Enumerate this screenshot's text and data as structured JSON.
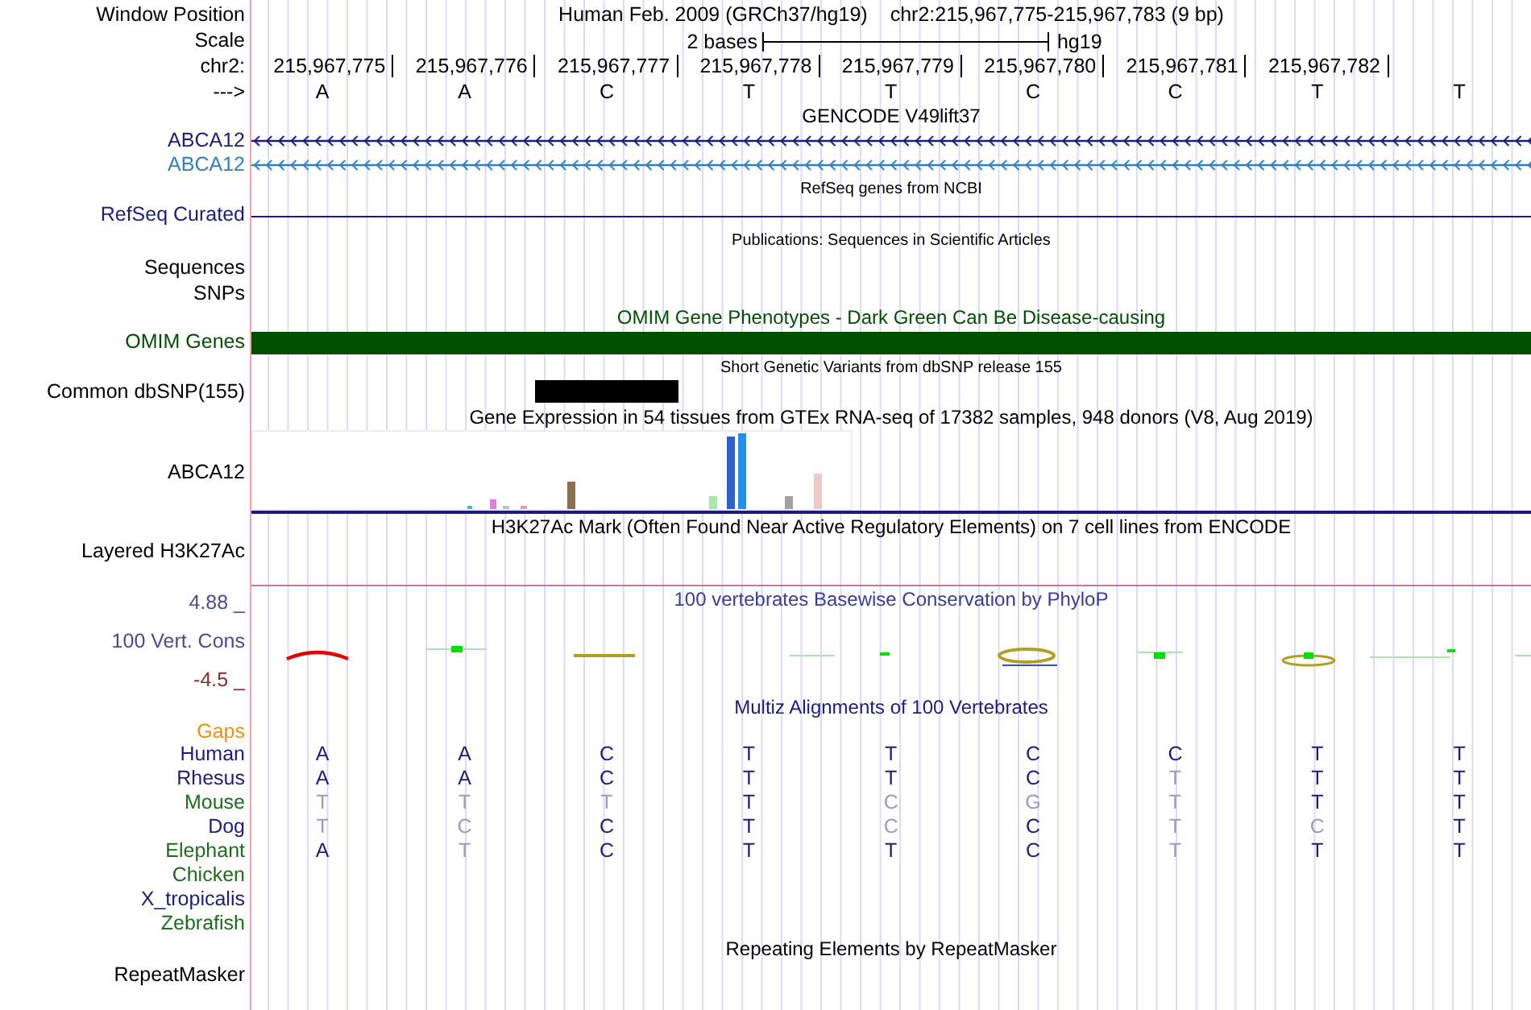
{
  "header": {
    "label": "Window Position",
    "title": "Human Feb. 2009 (GRCh37/hg19)",
    "position": "chr2:215,967,775-215,967,783 (9 bp)"
  },
  "scale": {
    "label": "Scale",
    "span": "2 bases",
    "assembly": "hg19"
  },
  "ruler": {
    "label": "chr2:",
    "positions": [
      "215,967,775",
      "215,967,776",
      "215,967,777",
      "215,967,778",
      "215,967,779",
      "215,967,780",
      "215,967,781",
      "215,967,782"
    ]
  },
  "sequence": {
    "label": "--->",
    "bases": [
      "A",
      "A",
      "C",
      "T",
      "T",
      "C",
      "C",
      "T",
      "T"
    ]
  },
  "gencode": {
    "heading": "GENCODE V49lift37",
    "transcripts": [
      {
        "label": "ABCA12",
        "color": "#1c1c80"
      },
      {
        "label": "ABCA12",
        "color": "#2e80c0"
      }
    ]
  },
  "refseq": {
    "heading": "RefSeq genes from NCBI",
    "label": "RefSeq Curated"
  },
  "publications": {
    "heading": "Publications: Sequences in Scientific Articles",
    "label_lines": [
      "Sequences",
      "SNPs"
    ]
  },
  "omim": {
    "heading": "OMIM Gene Phenotypes - Dark Green Can Be Disease-causing",
    "label": "OMIM Genes"
  },
  "dbsnp": {
    "heading": "Short Genetic Variants from dbSNP release 155",
    "label": "Common dbSNP(155)"
  },
  "gtex": {
    "heading": "Gene Expression in 54 tissues from GTEx RNA-seq of 17382 samples, 948 donors (V8, Aug 2019)",
    "label": "ABCA12"
  },
  "h3k27ac": {
    "heading": "H3K27Ac Mark (Often Found Near Active Regulatory Elements) on 7 cell lines from ENCODE",
    "label": "Layered H3K27Ac"
  },
  "phylop": {
    "heading": "100 vertebrates Basewise Conservation by PhyloP",
    "max": "4.88 _",
    "label": "100 Vert. Cons",
    "min": "-4.5 _"
  },
  "multiz": {
    "heading": "Multiz Alignments of 100 Vertebrates",
    "gaps_label": "Gaps",
    "species": [
      {
        "name": "Human",
        "color": "#1c1c80",
        "bases": [
          {
            "base": "A",
            "match": true
          },
          {
            "base": "A",
            "match": true
          },
          {
            "base": "C",
            "match": true
          },
          {
            "base": "T",
            "match": true
          },
          {
            "base": "T",
            "match": true
          },
          {
            "base": "C",
            "match": true
          },
          {
            "base": "C",
            "match": true
          },
          {
            "base": "T",
            "match": true
          },
          {
            "base": "T",
            "match": true
          }
        ]
      },
      {
        "name": "Rhesus",
        "color": "#1c1c80",
        "bases": [
          {
            "base": "A",
            "match": true
          },
          {
            "base": "A",
            "match": true
          },
          {
            "base": "C",
            "match": true
          },
          {
            "base": "T",
            "match": true
          },
          {
            "base": "T",
            "match": true
          },
          {
            "base": "C",
            "match": true
          },
          {
            "base": "T",
            "match": false
          },
          {
            "base": "T",
            "match": true
          },
          {
            "base": "T",
            "match": true
          }
        ]
      },
      {
        "name": "Mouse",
        "color": "#1a6e1a",
        "bases": [
          {
            "base": "T",
            "match": false
          },
          {
            "base": "T",
            "match": false
          },
          {
            "base": "T",
            "match": false
          },
          {
            "base": "T",
            "match": true
          },
          {
            "base": "C",
            "match": false
          },
          {
            "base": "G",
            "match": false
          },
          {
            "base": "T",
            "match": false
          },
          {
            "base": "T",
            "match": true
          },
          {
            "base": "T",
            "match": true
          }
        ]
      },
      {
        "name": "Dog",
        "color": "#1c1c80",
        "bases": [
          {
            "base": "T",
            "match": false
          },
          {
            "base": "C",
            "match": false
          },
          {
            "base": "C",
            "match": true
          },
          {
            "base": "T",
            "match": true
          },
          {
            "base": "C",
            "match": false
          },
          {
            "base": "C",
            "match": true
          },
          {
            "base": "T",
            "match": false
          },
          {
            "base": "C",
            "match": false
          },
          {
            "base": "T",
            "match": true
          }
        ]
      },
      {
        "name": "Elephant",
        "color": "#1a6e1a",
        "bases": [
          {
            "base": "A",
            "match": true
          },
          {
            "base": "T",
            "match": false
          },
          {
            "base": "C",
            "match": true
          },
          {
            "base": "T",
            "match": true
          },
          {
            "base": "T",
            "match": true
          },
          {
            "base": "C",
            "match": true
          },
          {
            "base": "T",
            "match": false
          },
          {
            "base": "T",
            "match": true
          },
          {
            "base": "T",
            "match": true
          }
        ]
      },
      {
        "name": "Chicken",
        "color": "#1a6e1a"
      },
      {
        "name": "X_tropicalis",
        "color": "#1c1c80"
      },
      {
        "name": "Zebrafish",
        "color": "#1a6e1a"
      }
    ]
  },
  "repeatmasker": {
    "heading": "Repeating Elements by RepeatMasker",
    "label": "RepeatMasker"
  }
}
